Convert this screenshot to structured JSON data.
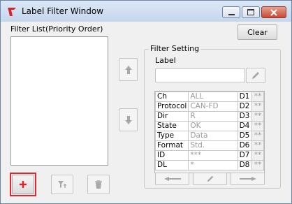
{
  "window": {
    "title": "Label Filter Window"
  },
  "filter_list": {
    "label": "Filter List(Priority Order)",
    "items": []
  },
  "buttons": {
    "clear": "Clear"
  },
  "filter_setting": {
    "group_title": "Filter Setting",
    "label_caption": "Label",
    "label_value": "",
    "rows": [
      {
        "name": "Ch",
        "value": "ALL",
        "code": "D1",
        "flag": "**"
      },
      {
        "name": "Protocol",
        "value": "CAN-FD",
        "code": "D2",
        "flag": "**"
      },
      {
        "name": "Dir",
        "value": "R",
        "code": "D3",
        "flag": "**"
      },
      {
        "name": "State",
        "value": "OK",
        "code": "D4",
        "flag": "**"
      },
      {
        "name": "Type",
        "value": "Data",
        "code": "D5",
        "flag": "**"
      },
      {
        "name": "Format",
        "value": "Std.",
        "code": "D6",
        "flag": "**"
      },
      {
        "name": "ID",
        "value": "***",
        "code": "D7",
        "flag": "**"
      },
      {
        "name": "DL",
        "value": "*",
        "code": "D8",
        "flag": "**"
      }
    ]
  },
  "colors": {
    "accent_red": "#e3262e",
    "add_plus": "#d9232d",
    "icon_gray": "#a8a8a8"
  }
}
